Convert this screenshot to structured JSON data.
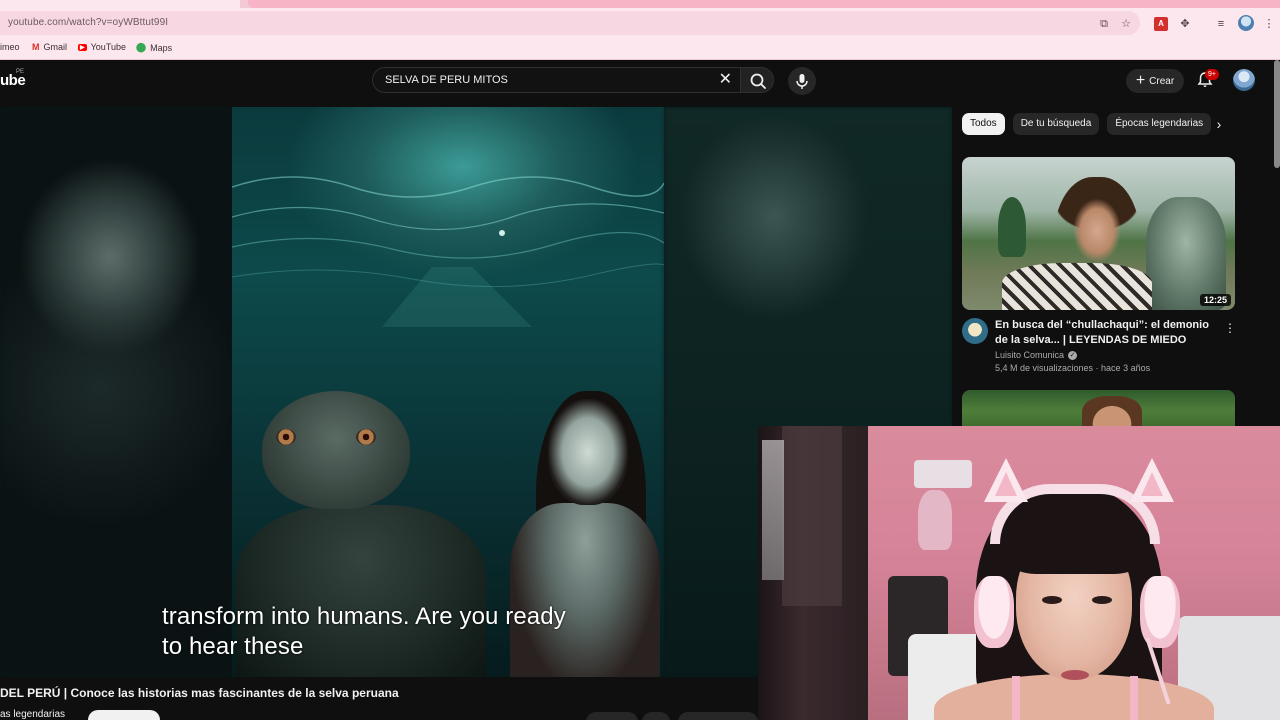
{
  "browser": {
    "url": "youtube.com/watch?v=oyWBttut99I",
    "bookmarks": [
      {
        "label": "imeo",
        "icon": "bookmark-icon"
      },
      {
        "label": "Gmail",
        "icon": "gmail-icon"
      },
      {
        "label": "YouTube",
        "icon": "youtube-icon"
      },
      {
        "label": "Maps",
        "icon": "maps-icon"
      }
    ]
  },
  "youtube": {
    "logo": "ube",
    "region": "PE",
    "search_query": "SELVA DE PERU MITOS",
    "create_label": "Crear",
    "notifications": "9+",
    "accent": "#cc0000"
  },
  "video": {
    "caption_line1": "transform into humans. Are you ready",
    "caption_line2": "to hear these",
    "title": "DEL PERÚ | Conoce las historias mas fascinantes de la selva peruana",
    "channel_partial": "as legendarias"
  },
  "rail": {
    "chips": [
      {
        "label": "Todos",
        "active": true
      },
      {
        "label": "De tu búsqueda",
        "active": false
      },
      {
        "label": "Épocas legendarias",
        "active": false
      }
    ],
    "recommendations": [
      {
        "title": "En busca del “chullachaqui”: el demonio de la selva... | LEYENDAS DE MIEDO",
        "channel": "Luisito Comunica",
        "meta": "5,4 M de visualizaciones · hace 3 años",
        "duration": "12:25",
        "verified": true
      }
    ]
  }
}
